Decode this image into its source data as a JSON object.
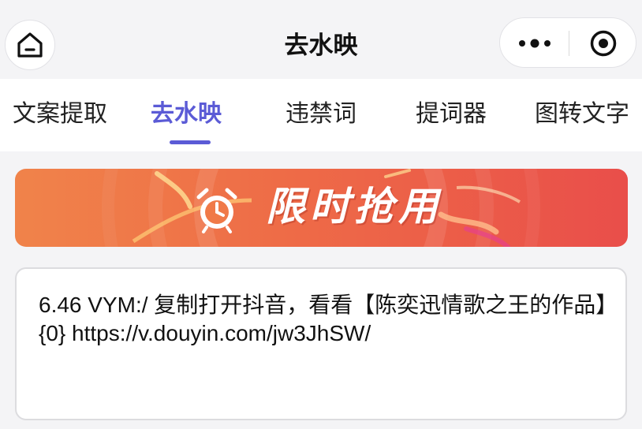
{
  "header": {
    "title": "去水映",
    "home_icon": "home-icon",
    "more_icon": "more-dots-icon",
    "close_icon": "target-circle-icon"
  },
  "tabs": [
    {
      "label": "文案提取",
      "active": false
    },
    {
      "label": "去水映",
      "active": true
    },
    {
      "label": "违禁词",
      "active": false
    },
    {
      "label": "提词器",
      "active": false
    },
    {
      "label": "图转文字",
      "active": false
    }
  ],
  "banner": {
    "text": "限时抢用",
    "icon": "alarm-clock-icon"
  },
  "input": {
    "value": "6.46 VYM:/ 复制打开抖音，看看【陈奕迅情歌之王的作品】{0} https://v.douyin.com/jw3JhSW/"
  },
  "colors": {
    "accent": "#5b5bd6",
    "banner_start": "#f0834a",
    "banner_end": "#e94e4a",
    "page_bg": "#f4f4f6"
  }
}
